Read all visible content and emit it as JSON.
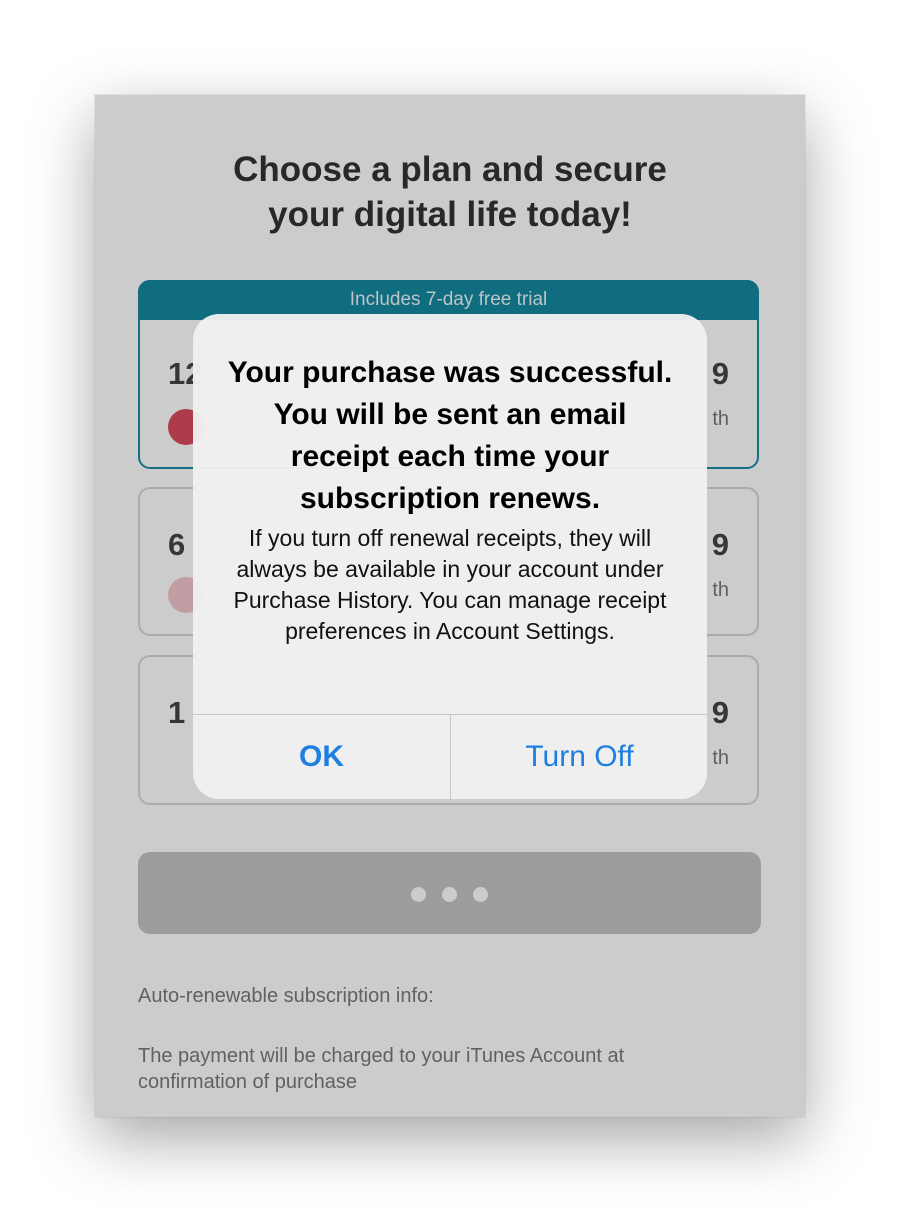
{
  "screen": {
    "title": "Choose a plan and secure\nyour digital life today!"
  },
  "plans": [
    {
      "ribbon": "Includes 7-day free trial",
      "duration": "12",
      "price": "9",
      "per": "th",
      "badge_color": "#d94a5d"
    },
    {
      "duration": "6",
      "price": "9",
      "per": "th",
      "badge_color": "#f2c6cc"
    },
    {
      "duration": "1",
      "price": "9",
      "per": "th"
    }
  ],
  "subscription_info": {
    "heading": "Auto-renewable subscription info:",
    "text": "The payment will be charged to your iTunes Account at confirmation of purchase"
  },
  "alert": {
    "title": "Your purchase was successful. You will be sent an email receipt each time your subscription renews.",
    "message": "If you turn off renewal receipts, they will always be available in your account under Purchase History. You can manage receipt preferences in Account Settings.",
    "buttons": {
      "ok": "OK",
      "turn_off": "Turn Off"
    }
  },
  "colors": {
    "accent": "#14889f",
    "link": "#1f7fe0"
  }
}
